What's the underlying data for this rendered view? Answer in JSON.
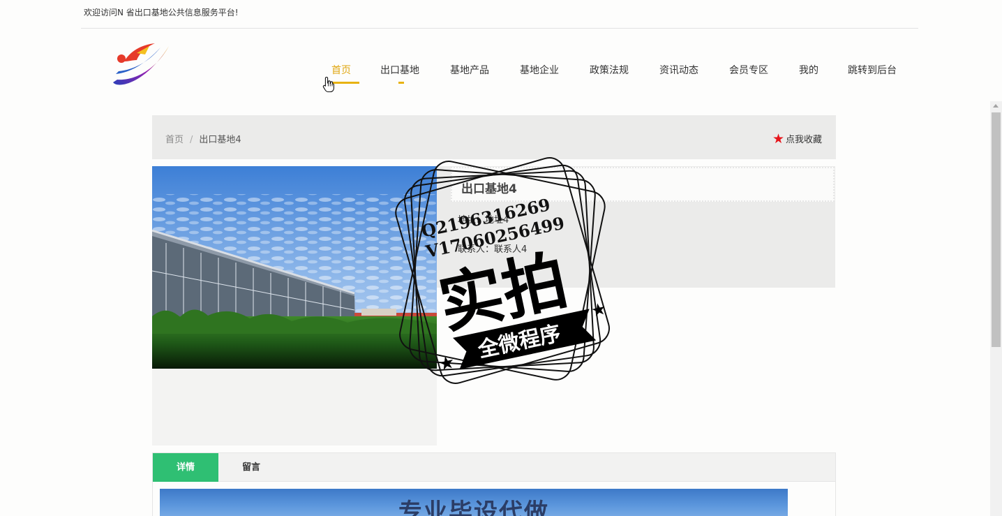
{
  "topbar": {
    "welcome": "欢迎访问N 省出口基地公共信息服务平台!"
  },
  "logo": {
    "icon": "dragon-swoosh-logo"
  },
  "nav": {
    "items": [
      {
        "label": "首页"
      },
      {
        "label": "出口基地"
      },
      {
        "label": "基地产品"
      },
      {
        "label": "基地企业"
      },
      {
        "label": "政策法规"
      },
      {
        "label": "资讯动态"
      },
      {
        "label": "会员专区"
      },
      {
        "label": "我的"
      },
      {
        "label": "跳转到后台"
      }
    ],
    "active_index": 0,
    "accent_color": "#e0a712"
  },
  "breadcrumb": {
    "home": "首页",
    "separator": "/",
    "current": "出口基地4"
  },
  "favorite": {
    "label": "点我收藏",
    "icon": "star-icon",
    "icon_color": "#e6151b"
  },
  "base_info": {
    "title": "出口基地4",
    "address": "地址：地址4",
    "contact": "联系人：联系人4"
  },
  "watermark": {
    "line1": "Q2196316269",
    "line2": "V17060256499",
    "big": "实拍",
    "ribbon": "全微程序"
  },
  "tabs": [
    {
      "label": "详情",
      "active": true
    },
    {
      "label": "留言",
      "active": false
    }
  ],
  "tab_active_color": "#2fbf73",
  "content": {
    "banner_text": "专业毕设代做"
  }
}
